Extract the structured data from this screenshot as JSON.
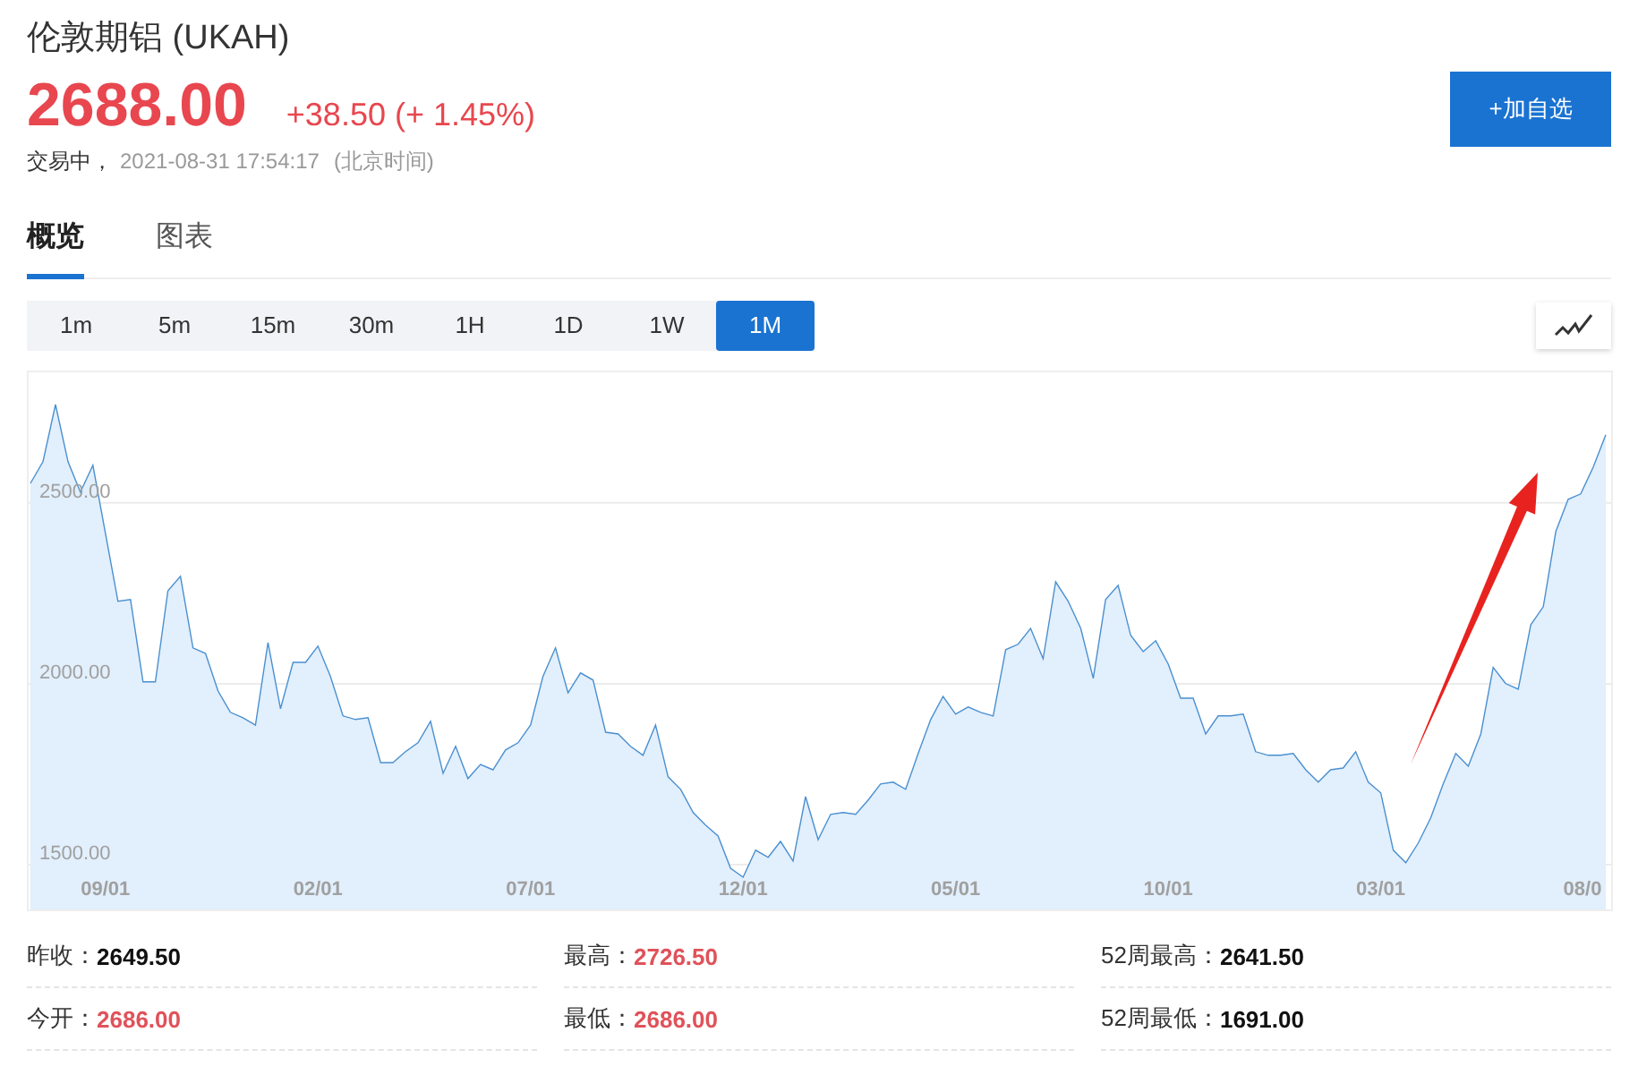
{
  "header": {
    "title": "伦敦期铝 (UKAH)",
    "price": "2688.00",
    "change": "+38.50 (+ 1.45%)",
    "status": "交易中，",
    "timestamp": "2021-08-31 17:54:17",
    "timezone": "(北京时间)",
    "watch_button": "+加自选"
  },
  "tabs": [
    {
      "label": "概览",
      "selected": true
    },
    {
      "label": "图表",
      "selected": false
    }
  ],
  "periods": [
    {
      "label": "1m",
      "selected": false
    },
    {
      "label": "5m",
      "selected": false
    },
    {
      "label": "15m",
      "selected": false
    },
    {
      "label": "30m",
      "selected": false
    },
    {
      "label": "1H",
      "selected": false
    },
    {
      "label": "1D",
      "selected": false
    },
    {
      "label": "1W",
      "selected": false
    },
    {
      "label": "1M",
      "selected": true
    }
  ],
  "chart": {
    "chart_data": {
      "type": "area",
      "ylim": [
        1376,
        2861
      ],
      "grid": true,
      "categories": [
        null,
        null,
        null,
        null,
        null,
        null,
        "09/01",
        null,
        null,
        null,
        null,
        null,
        null,
        null,
        null,
        null,
        null,
        null,
        null,
        null,
        null,
        null,
        null,
        "02/01",
        null,
        null,
        null,
        null,
        null,
        null,
        null,
        null,
        null,
        null,
        null,
        null,
        null,
        null,
        null,
        null,
        "07/01",
        null,
        null,
        null,
        null,
        null,
        null,
        null,
        null,
        null,
        null,
        null,
        null,
        null,
        null,
        null,
        null,
        "12/01",
        null,
        null,
        null,
        null,
        null,
        null,
        null,
        null,
        null,
        null,
        null,
        null,
        null,
        null,
        null,
        null,
        "05/01",
        null,
        null,
        null,
        null,
        null,
        null,
        null,
        null,
        null,
        null,
        null,
        null,
        null,
        null,
        null,
        null,
        "10/01",
        null,
        null,
        null,
        null,
        null,
        null,
        null,
        null,
        null,
        null,
        null,
        null,
        null,
        null,
        null,
        null,
        "03/01",
        null,
        null,
        null,
        null,
        null,
        null,
        null,
        null,
        null,
        null,
        null,
        null,
        null,
        null,
        null,
        null,
        "08/0",
        null
      ],
      "yticks": [
        {
          "value": 1500,
          "label": "1500.00"
        },
        {
          "value": 2000,
          "label": "2000.00"
        },
        {
          "value": 2500,
          "label": "2500.00"
        }
      ],
      "series": [
        {
          "color": "#4a90d0",
          "values": [
            2554,
            2614,
            2772,
            2614,
            2530,
            2604,
            2416,
            2228,
            2233,
            2005,
            2005,
            2257,
            2297,
            2099,
            2084,
            1980,
            1921,
            1906,
            1886,
            2114,
            1931,
            2059,
            2059,
            2104,
            2020,
            1911,
            1901,
            1906,
            1782,
            1782,
            1812,
            1837,
            1896,
            1752,
            1827,
            1738,
            1777,
            1762,
            1817,
            1837,
            1886,
            2020,
            2099,
            1975,
            2030,
            2010,
            1866,
            1861,
            1827,
            1802,
            1886,
            1743,
            1708,
            1644,
            1609,
            1579,
            1490,
            1465,
            1540,
            1520,
            1564,
            1510,
            1688,
            1569,
            1639,
            1644,
            1639,
            1678,
            1723,
            1728,
            1708,
            1807,
            1901,
            1965,
            1916,
            1936,
            1921,
            1911,
            2094,
            2109,
            2153,
            2069,
            2282,
            2228,
            2153,
            2015,
            2233,
            2272,
            2134,
            2089,
            2119,
            2054,
            1960,
            1960,
            1861,
            1911,
            1911,
            1916,
            1812,
            1802,
            1802,
            1807,
            1762,
            1728,
            1762,
            1767,
            1812,
            1728,
            1698,
            1540,
            1505,
            1559,
            1629,
            1723,
            1807,
            1772,
            1861,
            2045,
            2000,
            1985,
            2163,
            2213,
            2421,
            2510,
            2525,
            2599,
            2688
          ]
        }
      ]
    }
  },
  "stats": [
    {
      "label": "昨收：",
      "value": "2649.50",
      "color": "#111111"
    },
    {
      "label": "最高：",
      "value": "2726.50",
      "color": "#e0525a"
    },
    {
      "label": "52周最高：",
      "value": "2641.50",
      "color": "#111111"
    },
    {
      "label": "今开：",
      "value": "2686.00",
      "color": "#e0525a"
    },
    {
      "label": "最低：",
      "value": "2686.00",
      "color": "#e0525a"
    },
    {
      "label": "52周最低：",
      "value": "1691.00",
      "color": "#111111"
    }
  ]
}
